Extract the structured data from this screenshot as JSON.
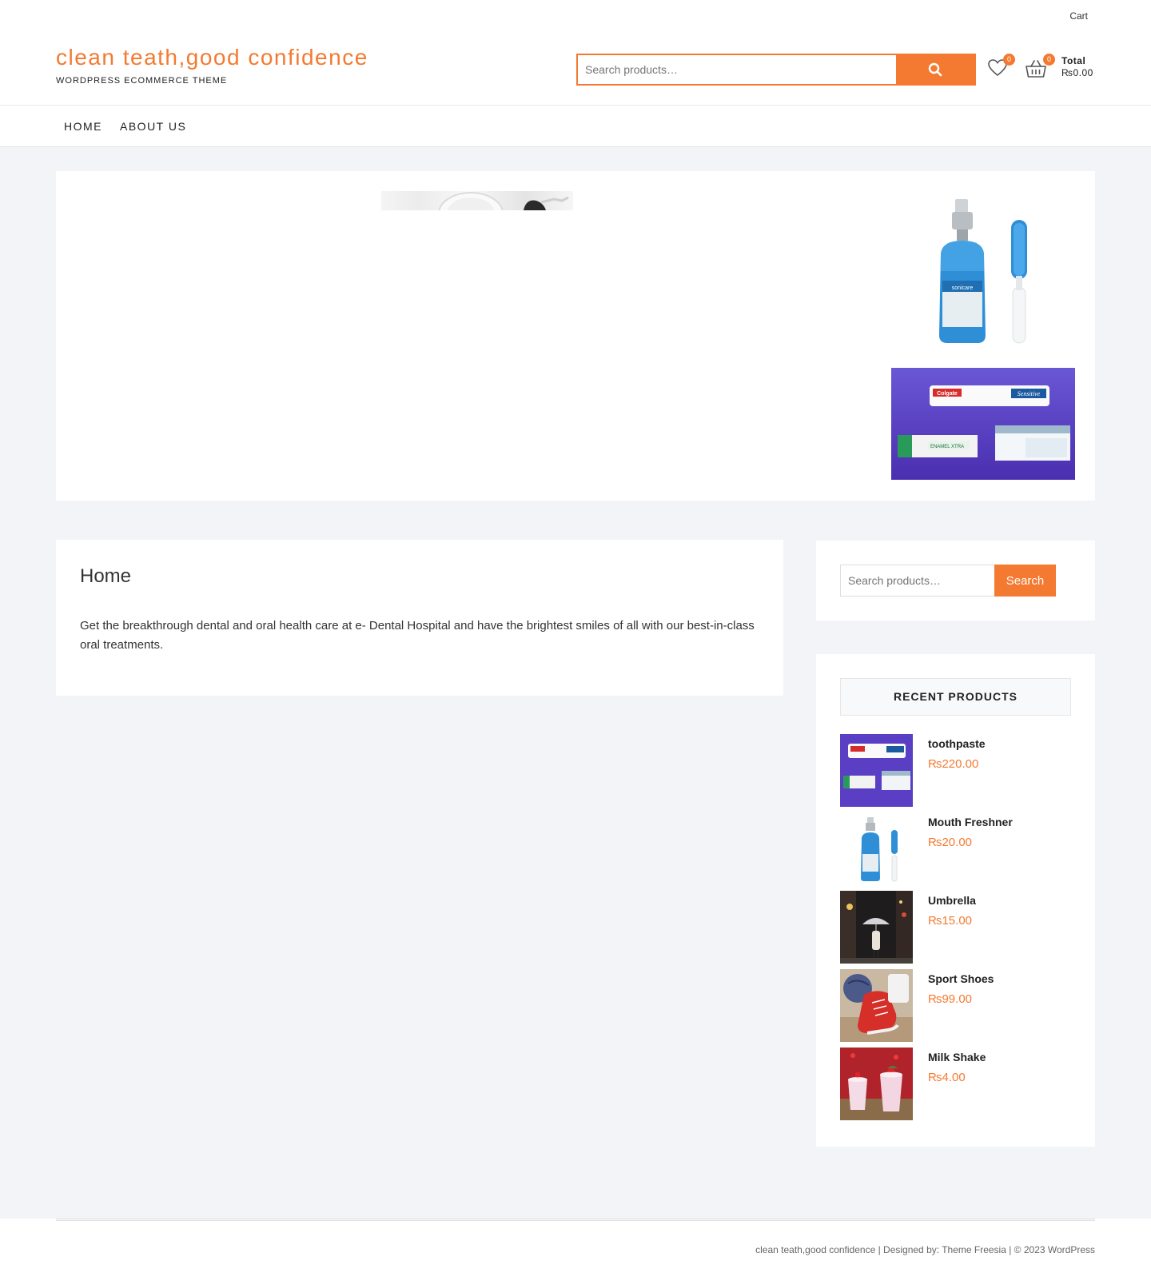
{
  "header": {
    "top_cart_link": "Cart",
    "site_title": "clean teath,good confidence",
    "site_description": "WORDPRESS ECOMMERCE THEME",
    "search_placeholder": "Search products…",
    "wishlist_count": "0",
    "cart_count": "0",
    "total_label": "Total",
    "total_value": "₨0.00"
  },
  "nav": {
    "items": [
      {
        "label": "HOME"
      },
      {
        "label": "ABOUT US"
      }
    ]
  },
  "main": {
    "title": "Home",
    "text": "Get the breakthrough dental and oral health care at e- Dental Hospital and have the brightest smiles of all with our best-in-class oral treatments."
  },
  "sidebar": {
    "search_placeholder": "Search products…",
    "search_button": "Search",
    "recent_title": "RECENT PRODUCTS",
    "products": [
      {
        "name": "toothpaste",
        "price": "₨220.00",
        "icon": "toothpaste-thumb"
      },
      {
        "name": "Mouth Freshner",
        "price": "₨20.00",
        "icon": "mouth-freshner-thumb"
      },
      {
        "name": "Umbrella",
        "price": "₨15.00",
        "icon": "umbrella-thumb"
      },
      {
        "name": "Sport Shoes",
        "price": "₨99.00",
        "icon": "sport-shoes-thumb"
      },
      {
        "name": "Milk Shake",
        "price": "₨4.00",
        "icon": "milk-shake-thumb"
      }
    ]
  },
  "footer": {
    "text": "clean teath,good confidence | Designed by: Theme Freesia | © 2023 WordPress"
  },
  "colors": {
    "accent": "#f47a31",
    "background": "#f3f4f7"
  }
}
